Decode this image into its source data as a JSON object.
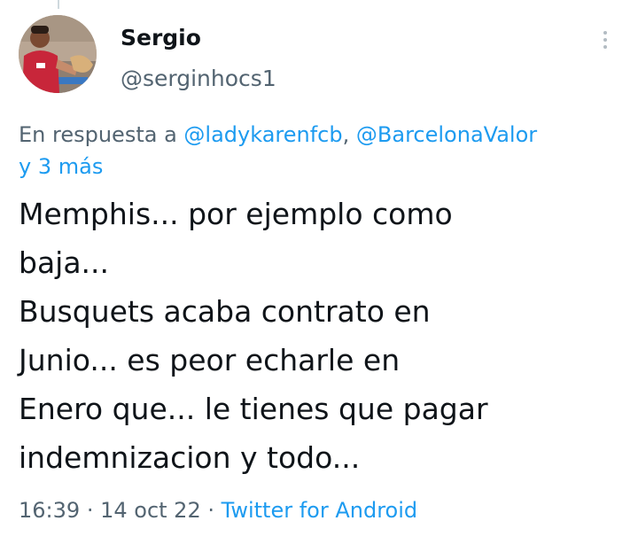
{
  "tweet": {
    "author": {
      "display_name": "Sergio",
      "handle": "@serginhocs1"
    },
    "reply_to": {
      "prefix": "En respuesta a",
      "mentions": [
        "@ladykarenfcb",
        "@BarcelonaValor"
      ],
      "more": "y 3 más"
    },
    "text": "Memphis... por ejemplo como\nbaja...\nBusquets acaba contrato en\nJunio... es peor echarle en\nEnero que... le tienes que pagar\nindemnizacion y todo...",
    "time": "16:39",
    "date": "14 oct 22",
    "separator": "·",
    "source": "Twitter for Android"
  },
  "colors": {
    "text": "#0f1419",
    "secondary": "#536471",
    "link": "#1d9bf0"
  },
  "icons": {
    "more": "more-vertical-icon"
  }
}
